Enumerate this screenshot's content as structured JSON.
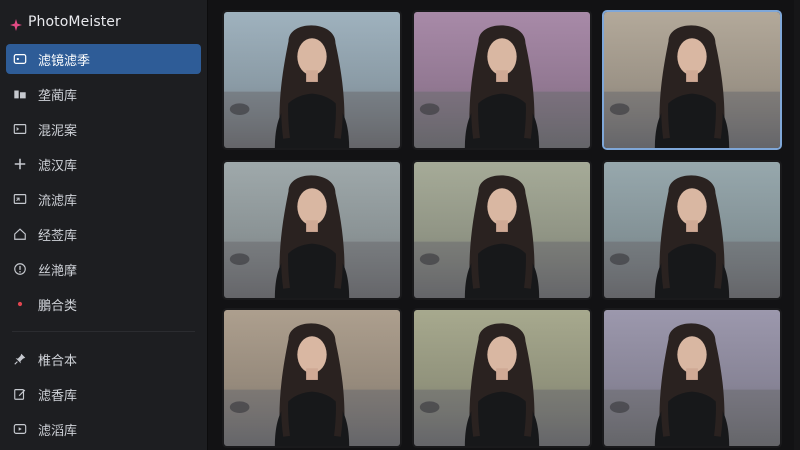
{
  "app": {
    "name": "PhotoMeister",
    "brand_icon": "sparkle-icon",
    "accent": "#e24a84",
    "active_bg": "#2e5c97"
  },
  "sidebar": {
    "items": [
      {
        "label": "滤镜滤季",
        "icon": "filter-icon",
        "active": true
      },
      {
        "label": "垄蔺库",
        "icon": "library-icon"
      },
      {
        "label": "混泥案",
        "icon": "terminal-icon"
      },
      {
        "label": "滤汉库",
        "icon": "plus-icon"
      },
      {
        "label": "流滤库",
        "icon": "image-add-icon"
      },
      {
        "label": "经莶库",
        "icon": "home-icon"
      },
      {
        "label": "丝滟摩",
        "icon": "info-icon"
      },
      {
        "label": "鵬合类",
        "icon": "dot-icon"
      }
    ],
    "items2": [
      {
        "label": "椎合本",
        "icon": "pin-icon"
      },
      {
        "label": "滤香库",
        "icon": "edit-icon"
      },
      {
        "label": "滤滔库",
        "icon": "play-icon"
      }
    ]
  },
  "grid": {
    "thumbnails": [
      {
        "name": "thumbnail-1",
        "tint": "#9fb2be",
        "selected": false
      },
      {
        "name": "thumbnail-2",
        "tint": "#a88aa8",
        "selected": false
      },
      {
        "name": "thumbnail-3",
        "tint": "#b3a99a",
        "selected": true
      },
      {
        "name": "thumbnail-4",
        "tint": "#9fa9ab",
        "selected": false
      },
      {
        "name": "thumbnail-5",
        "tint": "#a6ab98",
        "selected": false
      },
      {
        "name": "thumbnail-6",
        "tint": "#97a8ad",
        "selected": false
      },
      {
        "name": "thumbnail-7",
        "tint": "#ad9f8e",
        "selected": false
      },
      {
        "name": "thumbnail-8",
        "tint": "#a7a98e",
        "selected": false
      },
      {
        "name": "thumbnail-9",
        "tint": "#9c98ad",
        "selected": false
      }
    ]
  }
}
